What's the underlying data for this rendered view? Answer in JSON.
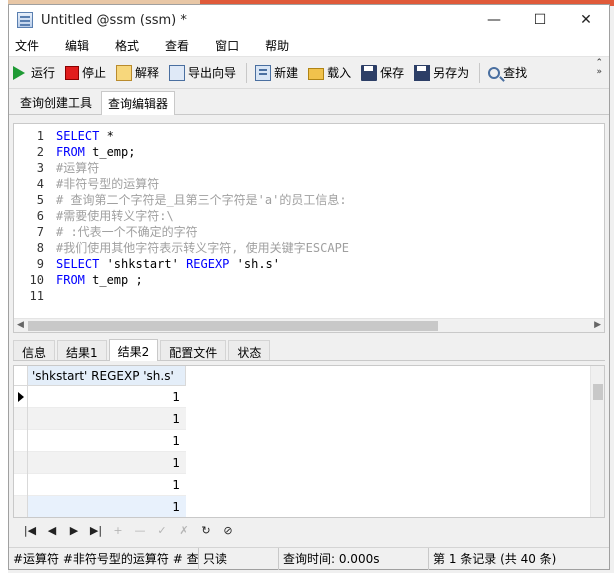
{
  "window": {
    "title": "Untitled @ssm (ssm) *",
    "controls": {
      "minimize": "—",
      "maximize": "☐",
      "close": "✕"
    }
  },
  "menu": [
    "文件",
    "编辑",
    "格式",
    "查看",
    "窗口",
    "帮助"
  ],
  "toolbar": {
    "run": "运行",
    "stop": "停止",
    "explain": "解释",
    "export": "导出向导",
    "new": "新建",
    "load": "载入",
    "save": "保存",
    "saveas": "另存为",
    "find": "查找"
  },
  "top_tabs": [
    "查询创建工具",
    "查询编辑器"
  ],
  "editor": {
    "lines": [
      {
        "n": "1",
        "parts": [
          [
            "kw",
            "SELECT"
          ],
          [
            "str",
            " *"
          ]
        ]
      },
      {
        "n": "2",
        "parts": [
          [
            "kw",
            "FROM"
          ],
          [
            "str",
            " t_emp;"
          ]
        ]
      },
      {
        "n": "3",
        "parts": [
          [
            "cm",
            "#运算符"
          ]
        ]
      },
      {
        "n": "4",
        "parts": [
          [
            "cm",
            "#非符号型的运算符"
          ]
        ]
      },
      {
        "n": "5",
        "parts": [
          [
            "cm",
            "# 查询第二个字符是_且第三个字符是'a'的员工信息:"
          ]
        ]
      },
      {
        "n": "6",
        "parts": [
          [
            "cm",
            "#需要使用转义字符:\\"
          ]
        ]
      },
      {
        "n": "7",
        "parts": [
          [
            "cm",
            "# :代表一个不确定的字符"
          ]
        ]
      },
      {
        "n": "8",
        "parts": [
          [
            "cm",
            "#我们使用其他字符表示转义字符, 使用关键字ESCAPE"
          ]
        ]
      },
      {
        "n": "9",
        "parts": [
          [
            "kw",
            "SELECT"
          ],
          [
            "str",
            " 'shkstart' "
          ],
          [
            "kw",
            "REGEXP"
          ],
          [
            "str",
            " 'sh.s'"
          ]
        ]
      },
      {
        "n": "10",
        "parts": [
          [
            "kw",
            "FROM"
          ],
          [
            "str",
            " t_emp ;"
          ]
        ]
      },
      {
        "n": "11",
        "parts": []
      }
    ]
  },
  "result_tabs": [
    "信息",
    "结果1",
    "结果2",
    "配置文件",
    "状态"
  ],
  "grid": {
    "header": "'shkstart' REGEXP 'sh.s'",
    "rows": [
      "1",
      "1",
      "1",
      "1",
      "1",
      "1"
    ]
  },
  "nav": [
    "|◀",
    "◀",
    "▶",
    "▶|",
    "+",
    "—",
    "✓",
    "✗",
    "↻",
    "⊘"
  ],
  "status": {
    "sql": "#运算符 #非符号型的运算符 # 查",
    "mode": "只读",
    "time": "查询时间: 0.000s",
    "records": "第 1 条记录 (共 40 条)"
  }
}
